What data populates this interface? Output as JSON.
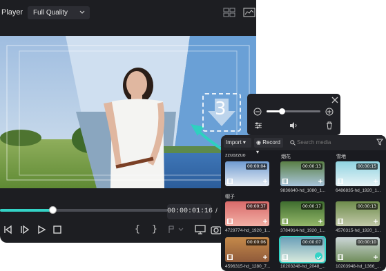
{
  "player": {
    "title": "Player",
    "quality": "Full Quality",
    "timecode": "00:00:01:16",
    "timecode_sep": "/",
    "progress": 0.31,
    "icons": [
      "compare-view-icon",
      "monitor-scope-icon",
      "prev-frame-icon",
      "play-step-icon",
      "play-icon",
      "stop-icon",
      "mark-in-icon",
      "mark-out-icon",
      "split-icon",
      "display-icon",
      "snapshot-icon"
    ],
    "mark_in": "{",
    "mark_out": "}"
  },
  "audio_popup": {
    "volume": 0.28,
    "icons": [
      "volume-down-icon",
      "volume-up-icon",
      "close-icon",
      "equalizer-icon",
      "speaker-icon",
      "trash-icon"
    ]
  },
  "drop_hint": {
    "number": "3"
  },
  "media": {
    "import_label": "Import",
    "record_label": "Record",
    "search_placeholder": "Search media",
    "folder_labels": [
      "zzuozzuo",
      "烟花",
      "雪地"
    ],
    "items": [
      {
        "duration": "00:00:04",
        "name": "",
        "selected": false
      },
      {
        "duration": "00:00:13",
        "name": "9836640-hd_1080_1...",
        "selected": false
      },
      {
        "duration": "00:00:15",
        "name": "6486835-hd_1920_1...",
        "selected": false
      },
      {
        "duration": "00:00:37",
        "name": "4729774-hd_1920_1...",
        "selected": false
      },
      {
        "duration": "00:00:17",
        "name": "3784914-hd_1920_1...",
        "selected": false
      },
      {
        "duration": "00:00:13",
        "name": "4570315-hd_1920_1...",
        "selected": false
      },
      {
        "duration": "00:00:06",
        "name": "4596315-hd_1280_7...",
        "selected": false
      },
      {
        "duration": "00:00:07",
        "name": "10203248-hd_2048_...",
        "selected": true
      },
      {
        "duration": "00:00:10",
        "name": "10203948-hd_1366_...",
        "selected": false
      }
    ],
    "row_label": "帽子"
  },
  "colors": {
    "accent": "#34d3c6",
    "panel": "#1d1e22"
  }
}
